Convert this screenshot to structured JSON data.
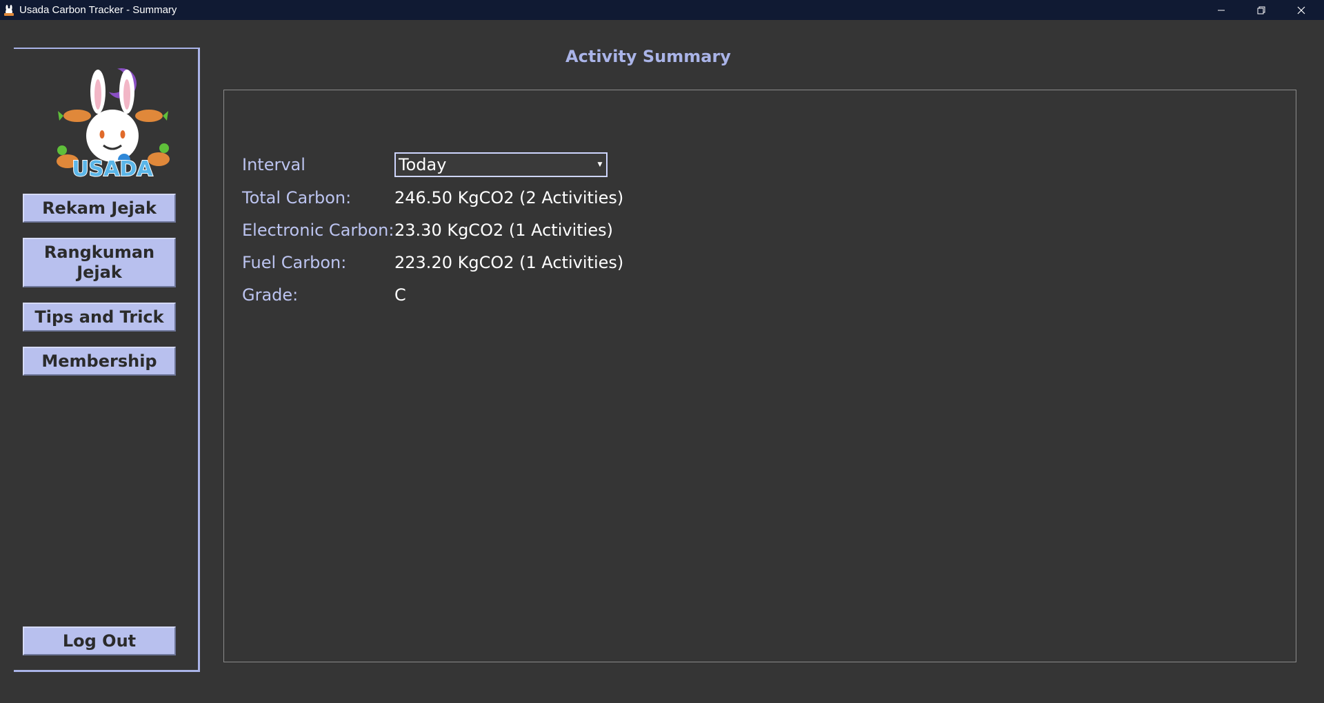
{
  "window": {
    "title": "Usada Carbon Tracker - Summary"
  },
  "sidebar": {
    "logo_text": "USADA",
    "buttons": {
      "rekam": "Rekam Jejak",
      "rangkuman_line1": "Rangkuman",
      "rangkuman_line2": "Jejak",
      "tips": "Tips and Trick",
      "membership": "Membership",
      "logout": "Log Out"
    }
  },
  "main": {
    "title": "Activity Summary",
    "interval": {
      "label": "Interval",
      "selected": "Today"
    },
    "rows": {
      "total": {
        "label": "Total Carbon:",
        "value": "246.50 KgCO2 (2 Activities)"
      },
      "electronic": {
        "label": "Electronic Carbon:",
        "value": "23.30 KgCO2 (1 Activities)"
      },
      "fuel": {
        "label": "Fuel Carbon:",
        "value": "223.20 KgCO2 (1 Activities)"
      },
      "grade": {
        "label": "Grade:",
        "value": "C"
      }
    }
  },
  "colors": {
    "background": "#353535",
    "titlebar": "#101a33",
    "accent": "#aab4e8",
    "button": "#b8c0ee"
  }
}
